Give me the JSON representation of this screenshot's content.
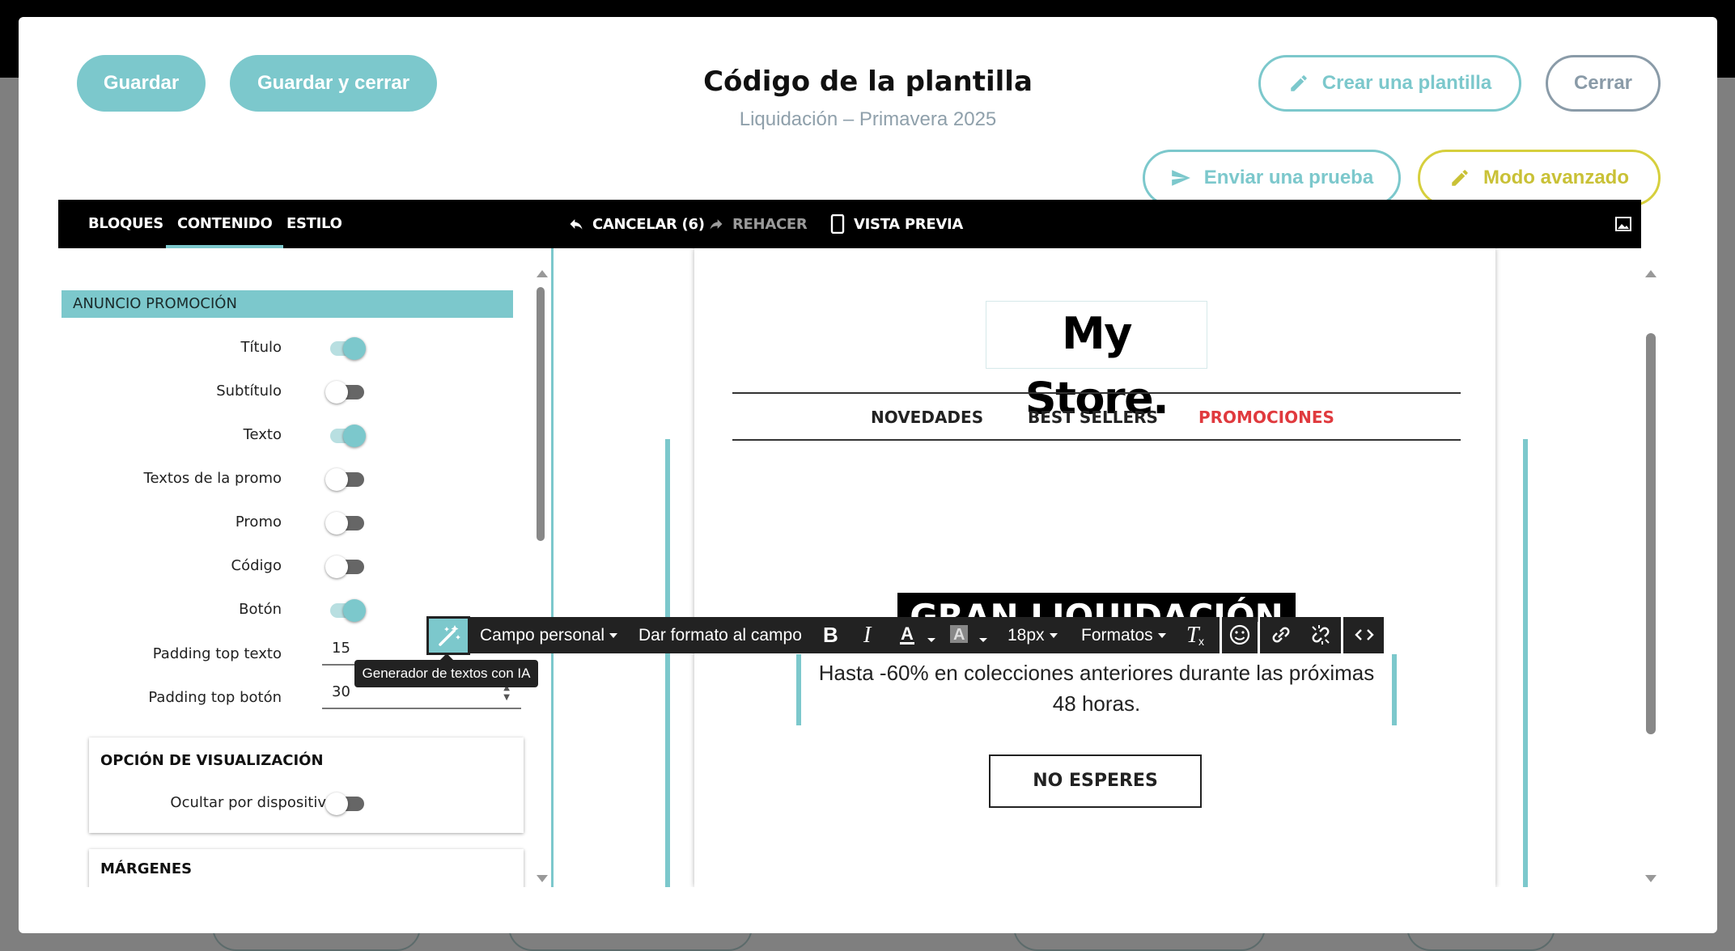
{
  "header": {
    "save_label": "Guardar",
    "save_close_label": "Guardar y cerrar",
    "title": "Código de la plantilla",
    "subtitle": "Liquidación – Primavera 2025",
    "create_template_label": "Crear una plantilla",
    "close_label": "Cerrar",
    "send_test_label": "Enviar una prueba",
    "advanced_mode_label": "Modo avanzado"
  },
  "editor_toolbar": {
    "tabs": [
      {
        "label": "BLOQUES",
        "active": false
      },
      {
        "label": "CONTENIDO",
        "active": true
      },
      {
        "label": "ESTILO",
        "active": false
      }
    ],
    "undo_label": "CANCELAR (6)",
    "redo_label": "REHACER",
    "preview_label": "VISTA PREVIA"
  },
  "left_panel": {
    "section_title": "ANUNCIO PROMOCIÓN",
    "toggles": [
      {
        "label": "Título",
        "on": true
      },
      {
        "label": "Subtítulo",
        "on": false
      },
      {
        "label": "Texto",
        "on": true
      },
      {
        "label": "Textos de la promo",
        "on": false
      },
      {
        "label": "Promo",
        "on": false
      },
      {
        "label": "Código",
        "on": false
      },
      {
        "label": "Botón",
        "on": true
      }
    ],
    "padding_top_text": {
      "label": "Padding top texto",
      "value": "15"
    },
    "padding_top_button": {
      "label": "Padding top botón",
      "value": "30"
    },
    "display_option": {
      "title": "OPCIÓN DE VISUALIZACIÓN",
      "label": "Ocultar por dispositivo",
      "on": false
    },
    "margins": {
      "title": "MÁRGENES"
    }
  },
  "email": {
    "logo": "My Store.",
    "nav": [
      "NOVEDADES",
      "BEST SELLERS",
      "PROMOCIONES"
    ],
    "headline": "GRAN LIQUIDACIÓN",
    "body_line1": "Hasta -60% en colecciones anteriores durante las próximas",
    "body_line2": "48 horas.",
    "cta": "NO ESPERES"
  },
  "rich_toolbar": {
    "custom_field": "Campo personal",
    "format_field": "Dar formato al campo",
    "font_size": "18px",
    "formats": "Formatos",
    "tooltip": "Generador de textos con IA"
  },
  "colors": {
    "accent": "#7cc8cc",
    "yellow": "#d6cf3d",
    "gray": "#8a9ba8",
    "promo_red": "#e03a3e"
  }
}
